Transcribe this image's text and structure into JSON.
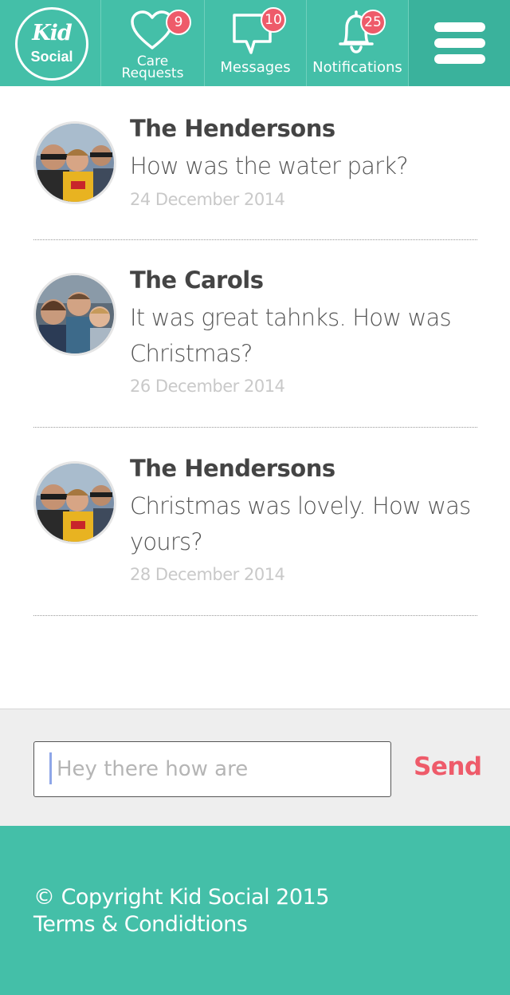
{
  "header": {
    "logo_top": "Kid",
    "logo_bottom": "Social",
    "nav": {
      "care_requests": {
        "label_line1": "Care",
        "label_line2": "Requests",
        "badge": "9"
      },
      "messages": {
        "label": "Messages",
        "badge": "10"
      },
      "notifications": {
        "label": "Notifications",
        "badge": "25"
      }
    }
  },
  "messages": [
    {
      "name": "The Hendersons",
      "text": "How was the water park?",
      "date": "24 December 2014"
    },
    {
      "name": "The Carols",
      "text": "It was great tahnks. How was Christmas?",
      "date": "26 December 2014"
    },
    {
      "name": "The Hendersons",
      "text": "Christmas was lovely. How was yours?",
      "date": "28 December 2014"
    }
  ],
  "composer": {
    "placeholder": "Hey there how are",
    "send_label": "Send"
  },
  "footer": {
    "copyright": "© Copyright Kid Social 2015",
    "terms": "Terms & Condidtions"
  },
  "colors": {
    "brand_teal": "#44bfa8",
    "badge_red": "#ee5b6a",
    "send_red": "#ee5b6a"
  }
}
